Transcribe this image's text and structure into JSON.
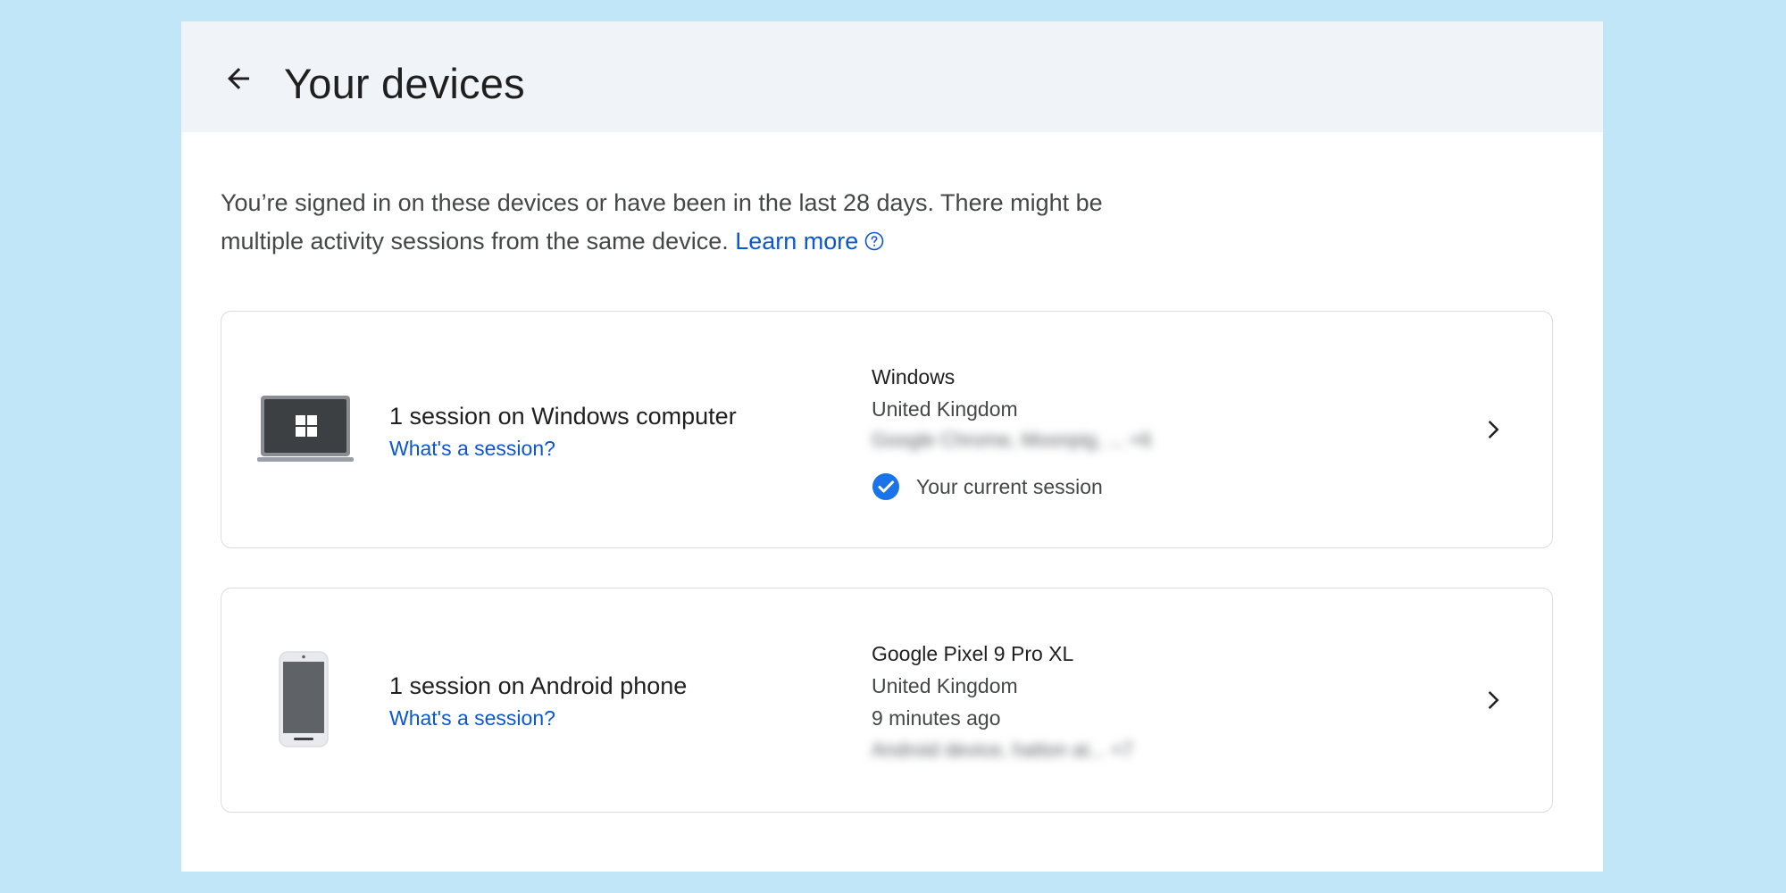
{
  "header": {
    "title": "Your devices"
  },
  "intro": {
    "text": "You’re signed in on these devices or have been in the last 28 days. There might be multiple activity sessions from the same device.",
    "learn_more": "Learn more"
  },
  "devices": [
    {
      "icon": "laptop-windows-icon",
      "title": "1 session on Windows computer",
      "link": "What's a session?",
      "name": "Windows",
      "location": "United Kingdom",
      "blurred_info": "Google Chrome, Moonpig, ... +6",
      "current_session": "Your current session"
    },
    {
      "icon": "android-phone-icon",
      "title": "1 session on Android phone",
      "link": "What's a session?",
      "name": "Google Pixel 9 Pro XL",
      "location": "United Kingdom",
      "last_seen": "9 minutes ago",
      "blurred_info": "Android device, hatton at... +7"
    }
  ],
  "colors": {
    "background": "#c0e6f8",
    "header": "#f0f4f9",
    "link": "#0b57d0",
    "check": "#1a73e8"
  }
}
